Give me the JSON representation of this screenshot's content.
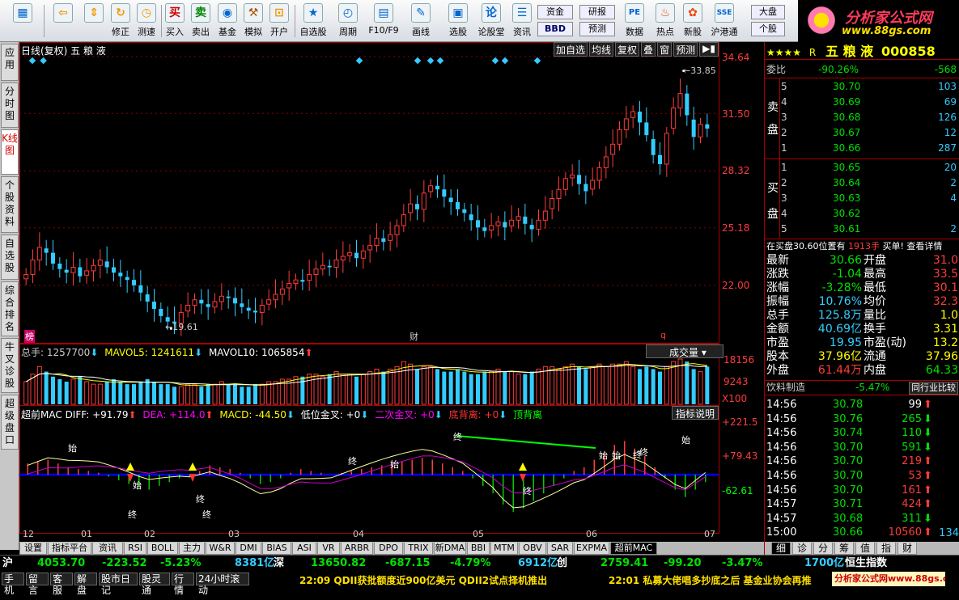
{
  "toolbar": {
    "buttons": [
      "",
      "",
      "修正",
      "测速",
      "买入",
      "卖出",
      "基金",
      "模拟",
      "开户",
      "自选股",
      "周期",
      "F10/F9",
      "画线",
      "选股",
      "论股堂",
      "资讯",
      "",
      "",
      "数据",
      "热点",
      "新股",
      "沪港通",
      "",
      ""
    ],
    "zixun": {
      "t1": "资金",
      "t2": "BBD",
      "t3": "研报",
      "t4": "预测",
      "t5": "大盘",
      "t6": "个股"
    },
    "logo": {
      "title": "分析家公式网",
      "url": "www.88gs.com"
    }
  },
  "left_tabs": [
    "应用",
    "分时图",
    "K线图",
    "个股资料",
    "自选股",
    "综合排名",
    "牛叉诊股",
    "超级盘口"
  ],
  "chart": {
    "title": "日线(复权) 五 粮 液",
    "top_buttons": [
      "加自选",
      "均线",
      "复权",
      "叠",
      "窗",
      "预测"
    ],
    "price_labels": [
      "34.64",
      "31.50",
      "28.32",
      "25.18",
      "22.00"
    ],
    "high_label": "33.85",
    "low_label": "19.61",
    "event_marks": [
      "榜",
      "财",
      "q"
    ],
    "volume_header": {
      "vol": "总手: 1257700",
      "mavol5": "MAVOL5: 1241611",
      "mavol10": "MAVOL10: 1065854"
    },
    "volume_selector": "成交量",
    "volume_labels": [
      "18156",
      "9243",
      "X100"
    ],
    "macd_header": {
      "name": "超前MAC",
      "diff": "DIFF: +91.79",
      "dea": "DEA: +114.0",
      "macd": "MACD: -44.50",
      "gold1": "低位金叉: +0",
      "gold2": "二次金叉: +0",
      "div": "底背离: +0",
      "top": "顶背离"
    },
    "macd_button": "指标说明",
    "macd_labels": [
      "+221.5",
      "+79.43",
      "-62.61"
    ],
    "macd_marks": [
      "始",
      "终",
      "始",
      "终",
      "始",
      "终",
      "终",
      "始",
      "始",
      "终",
      "终",
      "始",
      "终",
      "终"
    ],
    "x_labels": [
      "12",
      "01",
      "02",
      "03",
      "04",
      "05",
      "06",
      "07"
    ]
  },
  "chart_data": {
    "type": "candlestick",
    "title": "日线(复权) 五 粮 液",
    "ylim": [
      19.0,
      34.64
    ],
    "high": 33.85,
    "low": 19.61,
    "close_series": [
      22.6,
      23.4,
      24.1,
      23.8,
      23.2,
      22.9,
      22.7,
      23.0,
      22.5,
      22.8,
      23.1,
      23.4,
      23.0,
      22.7,
      22.5,
      22.3,
      22.0,
      21.6,
      21.1,
      20.7,
      20.3,
      20.0,
      19.9,
      20.5,
      20.9,
      21.2,
      21.0,
      20.8,
      21.1,
      21.4,
      21.3,
      21.0,
      20.8,
      20.6,
      20.5,
      20.9,
      21.2,
      21.5,
      21.8,
      22.1,
      22.3,
      22.2,
      22.6,
      22.9,
      23.1,
      23.0,
      23.4,
      23.6,
      23.8,
      23.5,
      23.9,
      24.2,
      24.6,
      24.4,
      24.8,
      25.3,
      25.9,
      26.5,
      26.2,
      27.1,
      27.5,
      27.3,
      26.9,
      26.6,
      26.2,
      26.0,
      25.6,
      25.2,
      25.0,
      25.3,
      25.5,
      25.2,
      25.6,
      25.8,
      25.4,
      25.1,
      25.6,
      26.1,
      26.8,
      27.3,
      27.9,
      28.1,
      27.6,
      27.2,
      27.8,
      28.5,
      29.1,
      29.8,
      30.6,
      31.2,
      31.6,
      31.0,
      30.3,
      29.2,
      28.7,
      30.4,
      31.8,
      32.6,
      31.4,
      30.2,
      30.9,
      30.66
    ],
    "volume_series": [
      9,
      12,
      15,
      13,
      11,
      10,
      9,
      10,
      11,
      9,
      8,
      8,
      9,
      10,
      9,
      8,
      8,
      9,
      10,
      9,
      8,
      8,
      7,
      7,
      8,
      8,
      7,
      8,
      8,
      9,
      8,
      8,
      7,
      7,
      8,
      8,
      9,
      9,
      10,
      10,
      11,
      11,
      12,
      12,
      11,
      12,
      13,
      12,
      12,
      11,
      12,
      13,
      14,
      13,
      14,
      15,
      17,
      16,
      14,
      15,
      15,
      14,
      13,
      13,
      14,
      13,
      12,
      12,
      13,
      13,
      14,
      13,
      13,
      12,
      12,
      13,
      14,
      15,
      15,
      14,
      15,
      16,
      15,
      14,
      15,
      16,
      15,
      16,
      16,
      17,
      15,
      14,
      15,
      14,
      13,
      15,
      17,
      18,
      17,
      14,
      13,
      15
    ],
    "macd_hist_series": [
      30,
      35,
      40,
      30,
      20,
      15,
      10,
      5,
      -5,
      -15,
      -25,
      -35,
      -40,
      -30,
      -20,
      -10,
      -5,
      10,
      25,
      20,
      15,
      5,
      -10,
      -25,
      -20,
      -10,
      5,
      15,
      10,
      5,
      0,
      5,
      10,
      15,
      20,
      25,
      30,
      35,
      40,
      45,
      40,
      30,
      20,
      10,
      -10,
      -30,
      -50,
      -80,
      -100,
      -90,
      -70,
      -50,
      -30,
      -10,
      10,
      20,
      40,
      60,
      80,
      90,
      70,
      50,
      20,
      -10,
      -40,
      -60,
      -40,
      -20
    ],
    "volume_ylim": [
      0,
      18156
    ],
    "macd_ylim": [
      -62.61,
      221.5
    ]
  },
  "bottom_tabs": [
    "设置",
    "指标平台",
    "资讯",
    "RSI",
    "BOLL",
    "主力",
    "W&R",
    "DMI",
    "BIAS",
    "ASI",
    "VR",
    "ARBR",
    "DPO",
    "TRIX",
    "新DMA",
    "BBI",
    "MTM",
    "OBV",
    "SAR",
    "EXPMA",
    "超前MAC"
  ],
  "right": {
    "header": {
      "stars": "★★★★",
      "r": "R",
      "name": "五 粮 液",
      "code": "000858"
    },
    "weibi": {
      "label": "委比",
      "pct": "-90.26%",
      "val": "-568"
    },
    "sell_label": [
      "卖",
      "盘"
    ],
    "buy_label": [
      "买",
      "盘"
    ],
    "sells": [
      {
        "n": "5",
        "p": "30.70",
        "v": "103"
      },
      {
        "n": "4",
        "p": "30.69",
        "v": "69"
      },
      {
        "n": "3",
        "p": "30.68",
        "v": "126"
      },
      {
        "n": "2",
        "p": "30.67",
        "v": "12"
      },
      {
        "n": "1",
        "p": "30.66",
        "v": "287"
      }
    ],
    "buys": [
      {
        "n": "1",
        "p": "30.65",
        "v": "20"
      },
      {
        "n": "2",
        "p": "30.64",
        "v": "2"
      },
      {
        "n": "3",
        "p": "30.63",
        "v": "4"
      },
      {
        "n": "4",
        "p": "30.62",
        "v": ""
      },
      {
        "n": "5",
        "p": "30.61",
        "v": "2"
      }
    ],
    "notice": {
      "a": "在买盘30.60位置有",
      "b": "1913手",
      "c": "买单! 查看详情"
    },
    "stats": [
      {
        "l1": "最新",
        "v1": "30.66",
        "l2": "开盘",
        "v2": "31.0"
      },
      {
        "l1": "涨跌",
        "v1": "-1.04",
        "l2": "最高",
        "v2": "33.5"
      },
      {
        "l1": "涨幅",
        "v1": "-3.28%",
        "l2": "最低",
        "v2": "30.1"
      },
      {
        "l1": "振幅",
        "v1": "10.76%",
        "l2": "均价",
        "v2": "32.3"
      },
      {
        "l1": "总手",
        "v1": "125.8万",
        "l2": "量比",
        "v2": "1.0"
      },
      {
        "l1": "金额",
        "v1": "40.69亿",
        "l2": "换手",
        "v2": "3.31"
      },
      {
        "l1": "市盈",
        "v1": "19.95",
        "l2": "市盈(动)",
        "v2": "13.2"
      },
      {
        "l1": "股本",
        "v1": "37.96亿",
        "l2": "流通",
        "v2": "37.96"
      },
      {
        "l1": "外盘",
        "v1": "61.44万",
        "l2": "内盘",
        "v2": "64.33"
      }
    ],
    "industry": {
      "name": "饮料制造",
      "pct": "-5.47%",
      "btn": "同行业比较"
    },
    "ticks": [
      {
        "t": "14:56",
        "p": "30.78",
        "v": "99",
        "d": "up"
      },
      {
        "t": "14:56",
        "p": "30.76",
        "v": "265",
        "d": "down"
      },
      {
        "t": "14:56",
        "p": "30.74",
        "v": "110",
        "d": "down"
      },
      {
        "t": "14:56",
        "p": "30.70",
        "v": "591",
        "d": "down"
      },
      {
        "t": "14:56",
        "p": "30.70",
        "v": "219",
        "d": "up"
      },
      {
        "t": "14:56",
        "p": "30.70",
        "v": "53",
        "d": "up"
      },
      {
        "t": "14:56",
        "p": "30.70",
        "v": "161",
        "d": "up"
      },
      {
        "t": "14:57",
        "p": "30.71",
        "v": "424",
        "d": "up"
      },
      {
        "t": "14:57",
        "p": "30.68",
        "v": "311",
        "d": "down"
      },
      {
        "t": "15:00",
        "p": "30.66",
        "v": "10560",
        "d": "up"
      }
    ],
    "ticks_extra": "134",
    "tabs": [
      "细",
      "诊",
      "分",
      "筹",
      "值",
      "指",
      "财"
    ]
  },
  "status": {
    "sh": {
      "l": "沪",
      "a": "4053.70",
      "b": "-223.52",
      "c": "-5.23%",
      "d": "8381亿"
    },
    "sz": {
      "l": "深",
      "a": "13650.82",
      "b": "-687.15",
      "c": "-4.79%",
      "d": "6912亿"
    },
    "cy": {
      "l": "创",
      "a": "2759.41",
      "b": "-99.20",
      "c": "-3.47%",
      "d": "1700亿"
    },
    "hk": "恒生指数",
    "tabs": [
      "手机",
      "留言",
      "客服",
      "解盘",
      "股市日记",
      "股灵通",
      "行情",
      "24小时滚动"
    ],
    "news1": "22:09 QDII获批额度近900亿美元 QDII2试点择机推出",
    "news2": "22:01 私募大佬唱多抄底之后 基金业协会再推",
    "watermark": "分析家公式网www.88gs.com"
  }
}
